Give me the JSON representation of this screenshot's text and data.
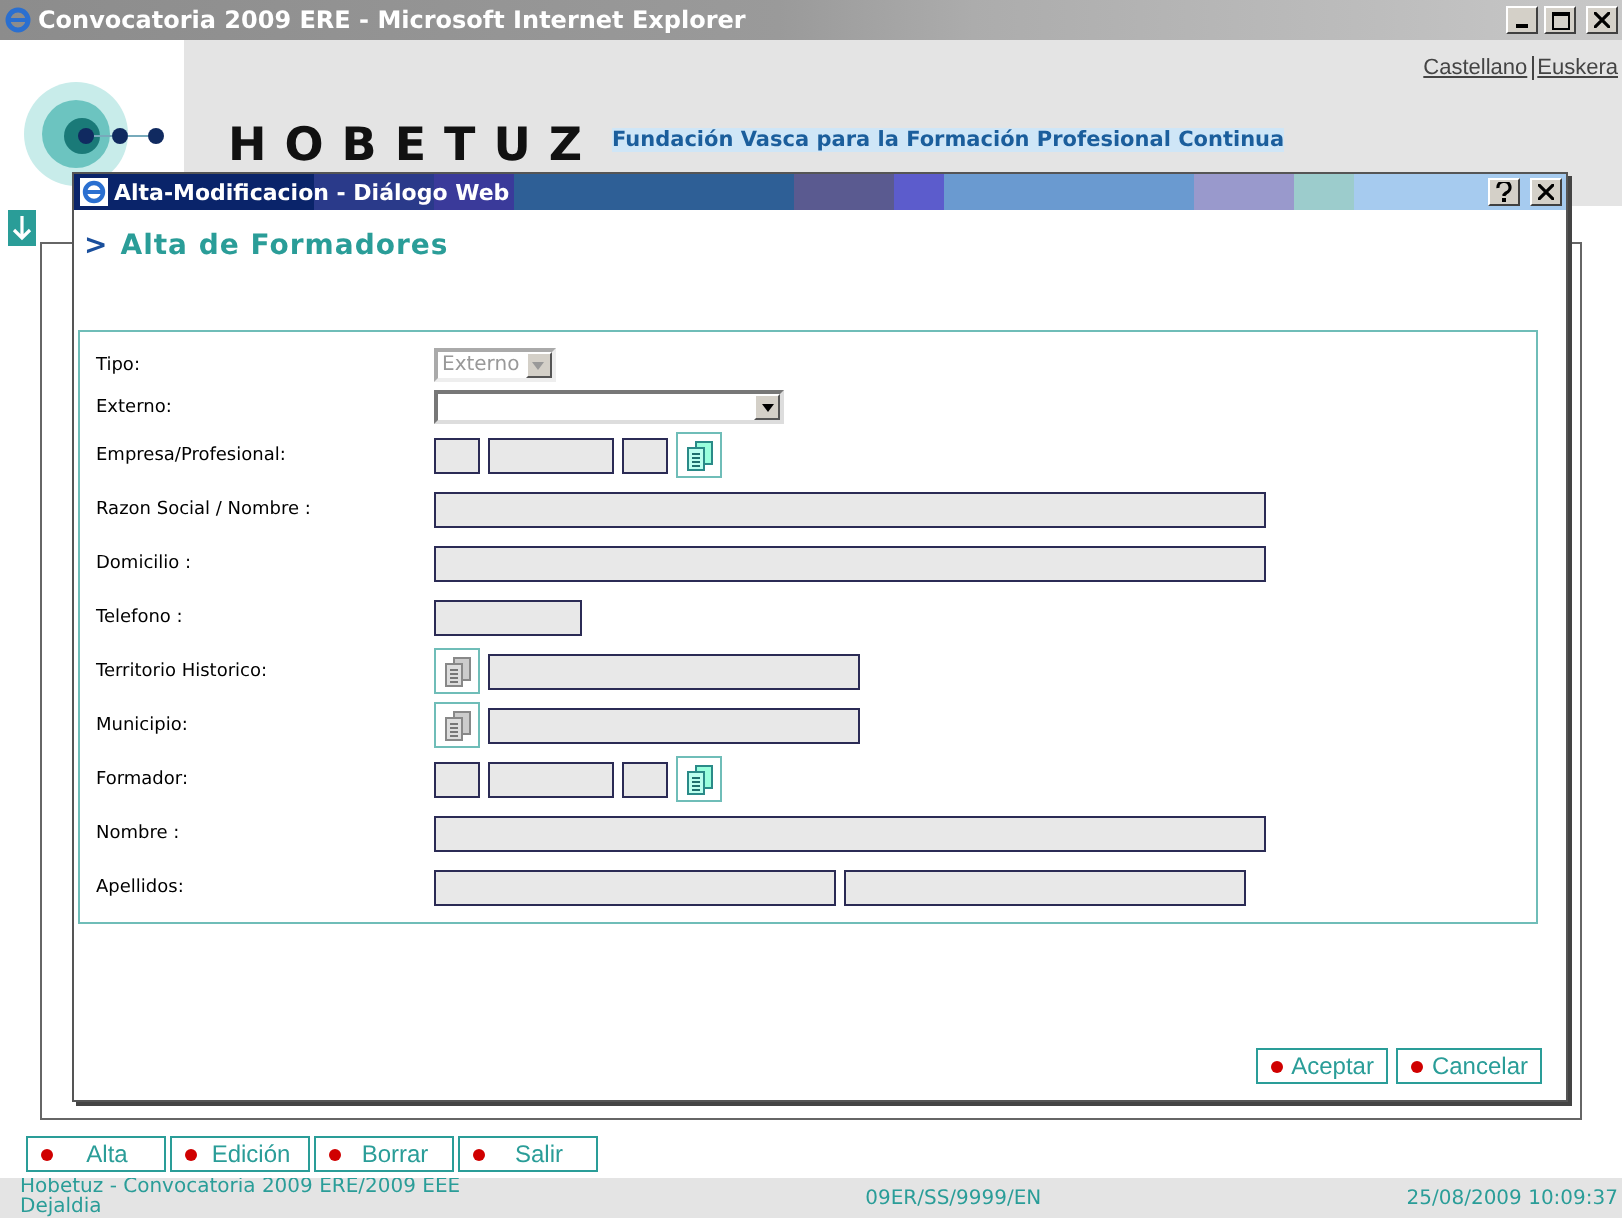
{
  "window": {
    "title": "Convocatoria 2009 ERE - Microsoft Internet Explorer"
  },
  "header": {
    "logo_text": "HOBETUZ",
    "tagline": "Fundación Vasca para la Formación Profesional Continua",
    "languages": [
      "Castellano",
      "Euskera"
    ]
  },
  "dialog": {
    "title": "Alta-Modificacion - Diálogo Web",
    "heading": "Alta de Formadores",
    "heading_marker": ">",
    "fields": [
      {
        "label": "Tipo:",
        "kind": "select",
        "value": "Externo",
        "disabled": true
      },
      {
        "label": "Externo:",
        "kind": "select",
        "disabled": false
      },
      {
        "label": "Empresa/Profesional:",
        "kind": "code-lookup"
      },
      {
        "label": "Razon Social / Nombre :",
        "kind": "wide-text"
      },
      {
        "label": "Domicilio :",
        "kind": "wide-text"
      },
      {
        "label": "Telefono :",
        "kind": "short-text"
      },
      {
        "label": "Territorio Historico:",
        "kind": "lookup-text"
      },
      {
        "label": "Municipio:",
        "kind": "lookup-text"
      },
      {
        "label": "Formador:",
        "kind": "code-lookup"
      },
      {
        "label": "Nombre :",
        "kind": "wide-text"
      },
      {
        "label": "Apellidos:",
        "kind": "split-text"
      }
    ],
    "buttons": [
      "Aceptar",
      "Cancelar"
    ]
  },
  "toolbar": [
    "Alta",
    "Edición",
    "Borrar",
    "Salir"
  ],
  "status_bar": {
    "left": "Hobetuz - Convocatoria 2009 ERE/2009 EEE Dejaldia",
    "center": "09ER/SS/9999/EN",
    "right": "25/08/2009 10:09:37"
  }
}
